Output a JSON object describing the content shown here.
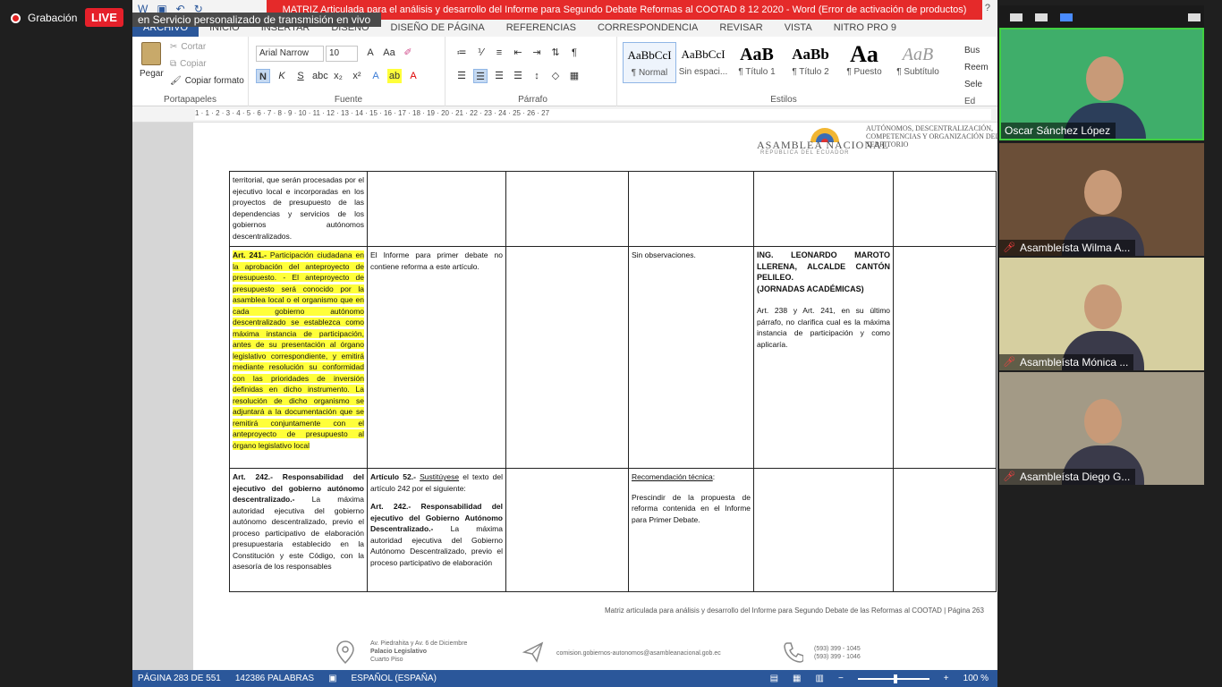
{
  "recording": {
    "label": "Grabación",
    "live": "LIVE"
  },
  "stream_banner": "en Servicio personalizado de transmisión en vivo",
  "word": {
    "window_title": "MATRIZ Articulada para el análisis y desarrollo del Informe para Segundo Debate Reformas al COOTAD 8 12 2020 -  Word (Error de activación de productos)",
    "tabs": [
      "ARCHIVO",
      "INICIO",
      "INSERTAR",
      "DISEÑO",
      "DISEÑO DE PÁGINA",
      "REFERENCIAS",
      "CORRESPONDENCIA",
      "REVISAR",
      "VISTA",
      "NITRO PRO 9"
    ],
    "ribbon": {
      "clipboard": {
        "label": "Portapapeles",
        "paste": "Pegar",
        "cut": "Cortar",
        "copy": "Copiar",
        "format_painter": "Copiar formato"
      },
      "font": {
        "label": "Fuente",
        "family": "Arial Narrow",
        "size": "10"
      },
      "paragraph": {
        "label": "Párrafo"
      },
      "styles": {
        "label": "Estilos",
        "items": [
          {
            "sample": "AaBbCcI",
            "name": "¶ Normal"
          },
          {
            "sample": "AaBbCcI",
            "name": "Sin espaci..."
          },
          {
            "sample": "AaB",
            "name": "¶ Título 1"
          },
          {
            "sample": "AaBb",
            "name": "¶ Título 2"
          },
          {
            "sample": "Aa",
            "name": "¶ Puesto"
          },
          {
            "sample": "AaB",
            "name": "¶ Subtítulo"
          }
        ]
      },
      "editing": {
        "label": "Ed",
        "find": "Bus",
        "replace": "Reem",
        "select": "Sele"
      }
    },
    "ruler_numbers": "1 · 1 · 2 · 3 · 4 · 5 · 6 · 7 · 8 · 9 · 10 · 11 · 12 · 13 · 14 · 15 · 16 · 17 · 18 · 19 · 20 · 21 · 22 · 23 · 24 · 25 · 26 · 27",
    "logo": {
      "name": "ASAMBLEA NACIONAL",
      "sub": "REPÚBLICA DEL ECUADOR",
      "commission": "AUTÓNOMOS, DESCENTRALIZACIÓN, COMPETENCIAS Y ORGANIZACIÓN DEL TERRITORIO"
    },
    "table": {
      "row1": {
        "c1": "territorial, que serán procesadas por el ejecutivo local e incorporadas en los proyectos de presupuesto de las dependencias y servicios de los gobiernos autónomos descentralizados."
      },
      "row2": {
        "c1_title": "Art. 241.-",
        "c1_text": " Participación ciudadana en la aprobación del anteproyecto de presupuesto. - El anteproyecto de presupuesto será conocido por la asamblea local o el organismo que en cada gobierno autónomo descentralizado se establezca como máxima instancia de participación, antes de su presentación al órgano legislativo correspondiente, y emitirá mediante resolución su conformidad con las prioridades de inversión definidas en dicho instrumento. La resolución de dicho organismo se adjuntará a la documentación que se remitirá conjuntamente con el anteproyecto de presupuesto al órgano legislativo local",
        "c2": "El Informe para primer debate no contiene reforma a este artículo.",
        "c4": "Sin observaciones.",
        "c5_title": "ING. LEONARDO MAROTO LLERENA, ALCALDE CANTÓN PELILEO.",
        "c5_sub": "(JORNADAS ACADÉMICAS)",
        "c5_text": "Art. 238 y Art. 241, en su último párrafo, no clarifica cual es la máxima instancia de participación y como aplicaría."
      },
      "row3": {
        "c1_title": "Art. 242.- Responsabilidad del ejecutivo del gobierno autónomo descentralizado.-",
        "c1_text": " La máxima autoridad ejecutiva del gobierno autónomo descentralizado, previo el proceso participativo de elaboración presupuestaria establecido en la Constitución y este Código, con la asesoría de los responsables",
        "c2_title": "Artículo 52.-",
        "c2_sust": "Sustitúyese",
        "c2_intro": " el texto del artículo  242 por el siguiente:",
        "c2_art": "Art. 242.- Responsabilidad del ejecutivo del Gobierno Autónomo Descentralizado.-",
        "c2_text": " La máxima autoridad ejecutiva del Gobierno Autónomo Descentralizado, previo el proceso participativo de elaboración",
        "c4_title": "Recomendación técnica",
        "c4_colon": ":",
        "c4_text": "Prescindir de la propuesta de reforma contenida en el Informe para Primer Debate."
      }
    },
    "footer": "Matriz articulada para análisis y desarrollo del Informe para Segundo Debate de las Reformas al COOTAD | Página 263",
    "address": {
      "line1": "Av. Piedrahita y Av. 6 de Diciembre",
      "line2": "Palacio Legislativo",
      "line3": "Cuarto Piso"
    },
    "email": "comision.gobiernos-autonomos@asambleanacional.gob.ec",
    "phones": {
      "p1": "(593) 399 - 1045",
      "p2": "(593) 399 - 1046"
    },
    "status": {
      "page": "PÁGINA 283 DE 551",
      "words": "142386 PALABRAS",
      "language": "ESPAÑOL (ESPAÑA)",
      "zoom": "100 %"
    }
  },
  "participants": [
    {
      "name": "Oscar Sánchez López",
      "muted": false,
      "speaking": true,
      "bg": "#3fae6a"
    },
    {
      "name": "Asambleísta Wilma A...",
      "muted": true,
      "speaking": false,
      "bg": "#6b4f38"
    },
    {
      "name": "Asambleísta Mónica ...",
      "muted": true,
      "speaking": false,
      "bg": "#d6cfa0"
    },
    {
      "name": "Asambleísta Diego G...",
      "muted": true,
      "speaking": false,
      "bg": "#a39a86"
    }
  ]
}
